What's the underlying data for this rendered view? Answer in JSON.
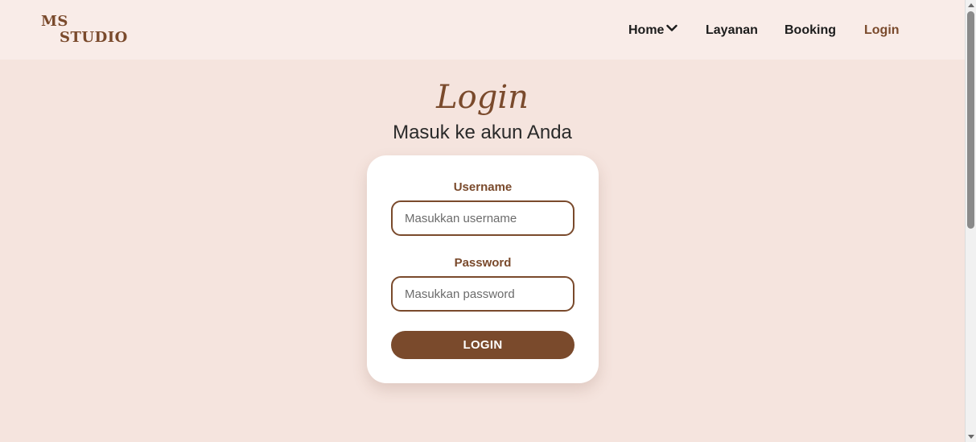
{
  "brand": {
    "line1": "MS",
    "line2": "STUDIO"
  },
  "nav": {
    "home": "Home",
    "layanan": "Layanan",
    "booking": "Booking",
    "login": "Login",
    "active": "login",
    "active_color": "#7a4a2c"
  },
  "header": {
    "title": "Login",
    "subtitle": "Masuk ke akun Anda"
  },
  "form": {
    "username_label": "Username",
    "username_placeholder": "Masukkan username",
    "username_value": "",
    "password_label": "Password",
    "password_placeholder": "Masukkan password",
    "password_value": "",
    "submit_label": "LOGIN"
  },
  "icons": {
    "home_dropdown": "chevron-down-icon"
  },
  "colors": {
    "brand_brown": "#7a4a2c",
    "page_background": "#f5e4de",
    "navbar_background": "#f9ece8",
    "card_background": "#ffffff"
  }
}
